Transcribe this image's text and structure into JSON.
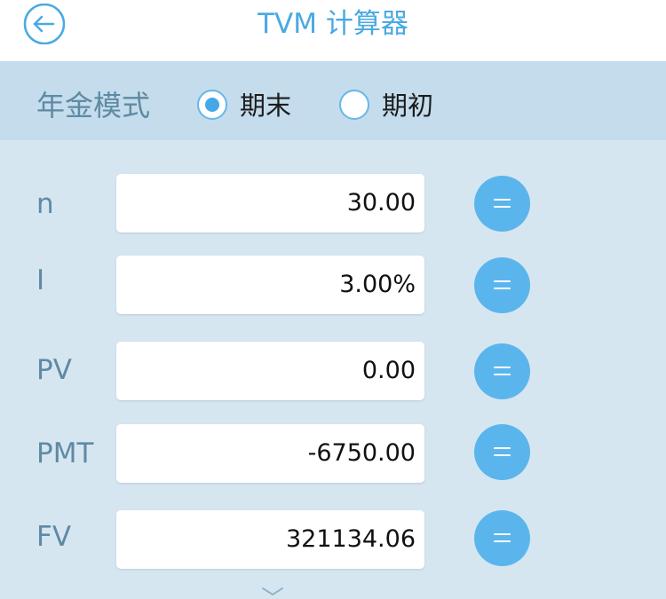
{
  "header": {
    "title": "TVM 计算器"
  },
  "annuity_mode": {
    "label": "年金模式",
    "options": [
      {
        "label": "期末",
        "selected": true
      },
      {
        "label": "期初",
        "selected": false
      }
    ]
  },
  "fields": [
    {
      "label": "n",
      "value": "30.00"
    },
    {
      "label": "I",
      "value": "3.00%"
    },
    {
      "label": "PV",
      "value": "0.00"
    },
    {
      "label": "PMT",
      "value": "-6750.00"
    },
    {
      "label": "FV",
      "value": "321134.06"
    }
  ],
  "colors": {
    "accent": "#4aa9e3",
    "button": "#5bb5ed",
    "background": "#d6e6f1",
    "mode_bar": "#c4dcec",
    "label_text": "#5f8aa4"
  },
  "icons": {
    "back": "back-arrow-circle-icon",
    "equals": "equals-icon",
    "expand": "chevron-down-icon"
  }
}
